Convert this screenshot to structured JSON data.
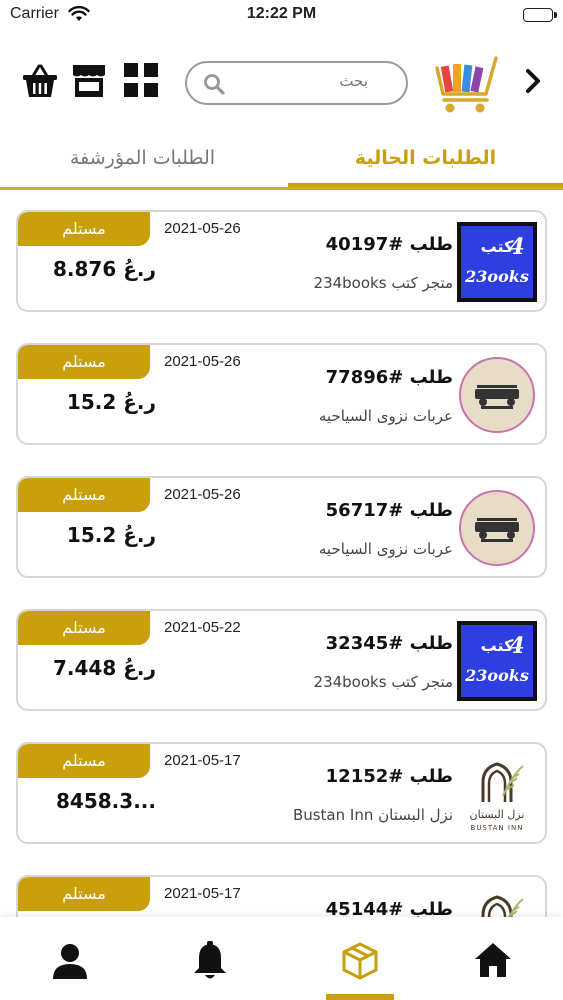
{
  "status_bar": {
    "carrier": "Carrier",
    "time": "12:22 PM"
  },
  "header": {
    "search": {
      "placeholder": "بحث"
    },
    "icons": [
      "basket-icon",
      "store-icon",
      "grid-icon",
      "search-icon",
      "cart-logo-icon",
      "chevron-right-icon"
    ]
  },
  "tabs": [
    {
      "label": "الطلبات الحالية",
      "active": true
    },
    {
      "label": "الطلبات المؤرشفة",
      "active": false
    }
  ],
  "colors": {
    "accent": "#c99f0e",
    "badge_text": "#ffffff",
    "card_border": "#d6d6d6"
  },
  "orders": [
    {
      "status": "مستلم",
      "date": "2021-05-26",
      "amount": "8.876 ر.عُ",
      "order_no": "طلب #40197",
      "store": "متجر كتب 234books",
      "thumb": "books"
    },
    {
      "status": "مستلم",
      "date": "2021-05-26",
      "amount": "15.2 ر.عُ",
      "order_no": "طلب #77896",
      "store": "عربات نزوى السياحيه",
      "thumb": "nizwa"
    },
    {
      "status": "مستلم",
      "date": "2021-05-26",
      "amount": "15.2 ر.عُ",
      "order_no": "طلب #56717",
      "store": "عربات نزوى السياحيه",
      "thumb": "nizwa"
    },
    {
      "status": "مستلم",
      "date": "2021-05-22",
      "amount": "7.448 ر.عُ",
      "order_no": "طلب #32345",
      "store": "متجر كتب 234books",
      "thumb": "books"
    },
    {
      "status": "مستلم",
      "date": "2021-05-17",
      "amount": "8458.3...",
      "order_no": "طلب #12152",
      "store": "نزل البستان Bustan Inn",
      "thumb": "bustan"
    },
    {
      "status": "مستلم",
      "date": "2021-05-17",
      "amount": "",
      "order_no": "طلب #45144",
      "store": "",
      "thumb": "bustan"
    }
  ],
  "thumb_text": {
    "books_top": "كتب",
    "books_num": "4",
    "books_bottom": "23ooks",
    "bustan_ar": "نزل البستان",
    "bustan_en": "BUSTAN INN"
  },
  "bottom_nav": [
    {
      "name": "home",
      "icon": "home-icon",
      "active": false
    },
    {
      "name": "orders",
      "icon": "box-icon",
      "active": true
    },
    {
      "name": "notifications",
      "icon": "bell-icon",
      "active": false
    },
    {
      "name": "profile",
      "icon": "user-icon",
      "active": false
    }
  ]
}
